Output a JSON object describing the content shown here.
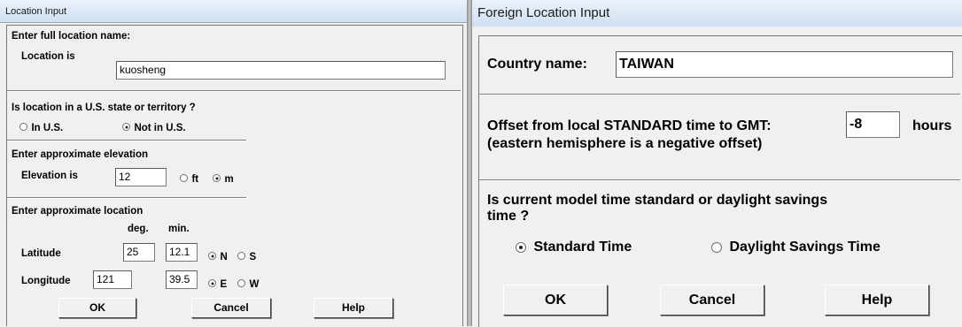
{
  "location_dialog": {
    "title": "Location Input",
    "enter_full_name": "Enter full location name:",
    "location_is_label": "Location is",
    "location_value": "kuosheng",
    "us_question": "Is location in a U.S. state or territory ?",
    "in_us_label": "In U.S.",
    "not_in_us_label": "Not in U.S.",
    "us_selected": "Not in U.S.",
    "elevation_heading": "Enter approximate elevation",
    "elevation_is_label": "Elevation is",
    "elevation_value": "12",
    "ft_label": "ft",
    "m_label": "m",
    "elevation_unit_selected": "m",
    "location_heading": "Enter approximate location",
    "deg_header": "deg.",
    "min_header": "min.",
    "latitude_label": "Latitude",
    "latitude_deg": "25",
    "latitude_min": "12.1",
    "n_label": "N",
    "s_label": "S",
    "lat_hemisphere_selected": "N",
    "longitude_label": "Longitude",
    "longitude_deg": "121",
    "longitude_min": "39.5",
    "e_label": "E",
    "w_label": "W",
    "lon_hemisphere_selected": "E",
    "ok_label": "OK",
    "cancel_label": "Cancel",
    "help_label": "Help"
  },
  "foreign_dialog": {
    "title": "Foreign Location Input",
    "country_label": "Country name:",
    "country_value": "TAIWAN",
    "offset_label": "Offset from local STANDARD time to GMT:",
    "offset_value": "-8",
    "hours_label": "hours",
    "offset_note": "(eastern hemisphere is a negative offset)",
    "time_question_line1": "Is current model time standard or daylight savings",
    "time_question_line2": "time ?",
    "standard_label": "Standard Time",
    "daylight_label": "Daylight Savings Time",
    "time_selected": "Standard Time",
    "ok_label": "OK",
    "cancel_label": "Cancel",
    "help_label": "Help"
  }
}
